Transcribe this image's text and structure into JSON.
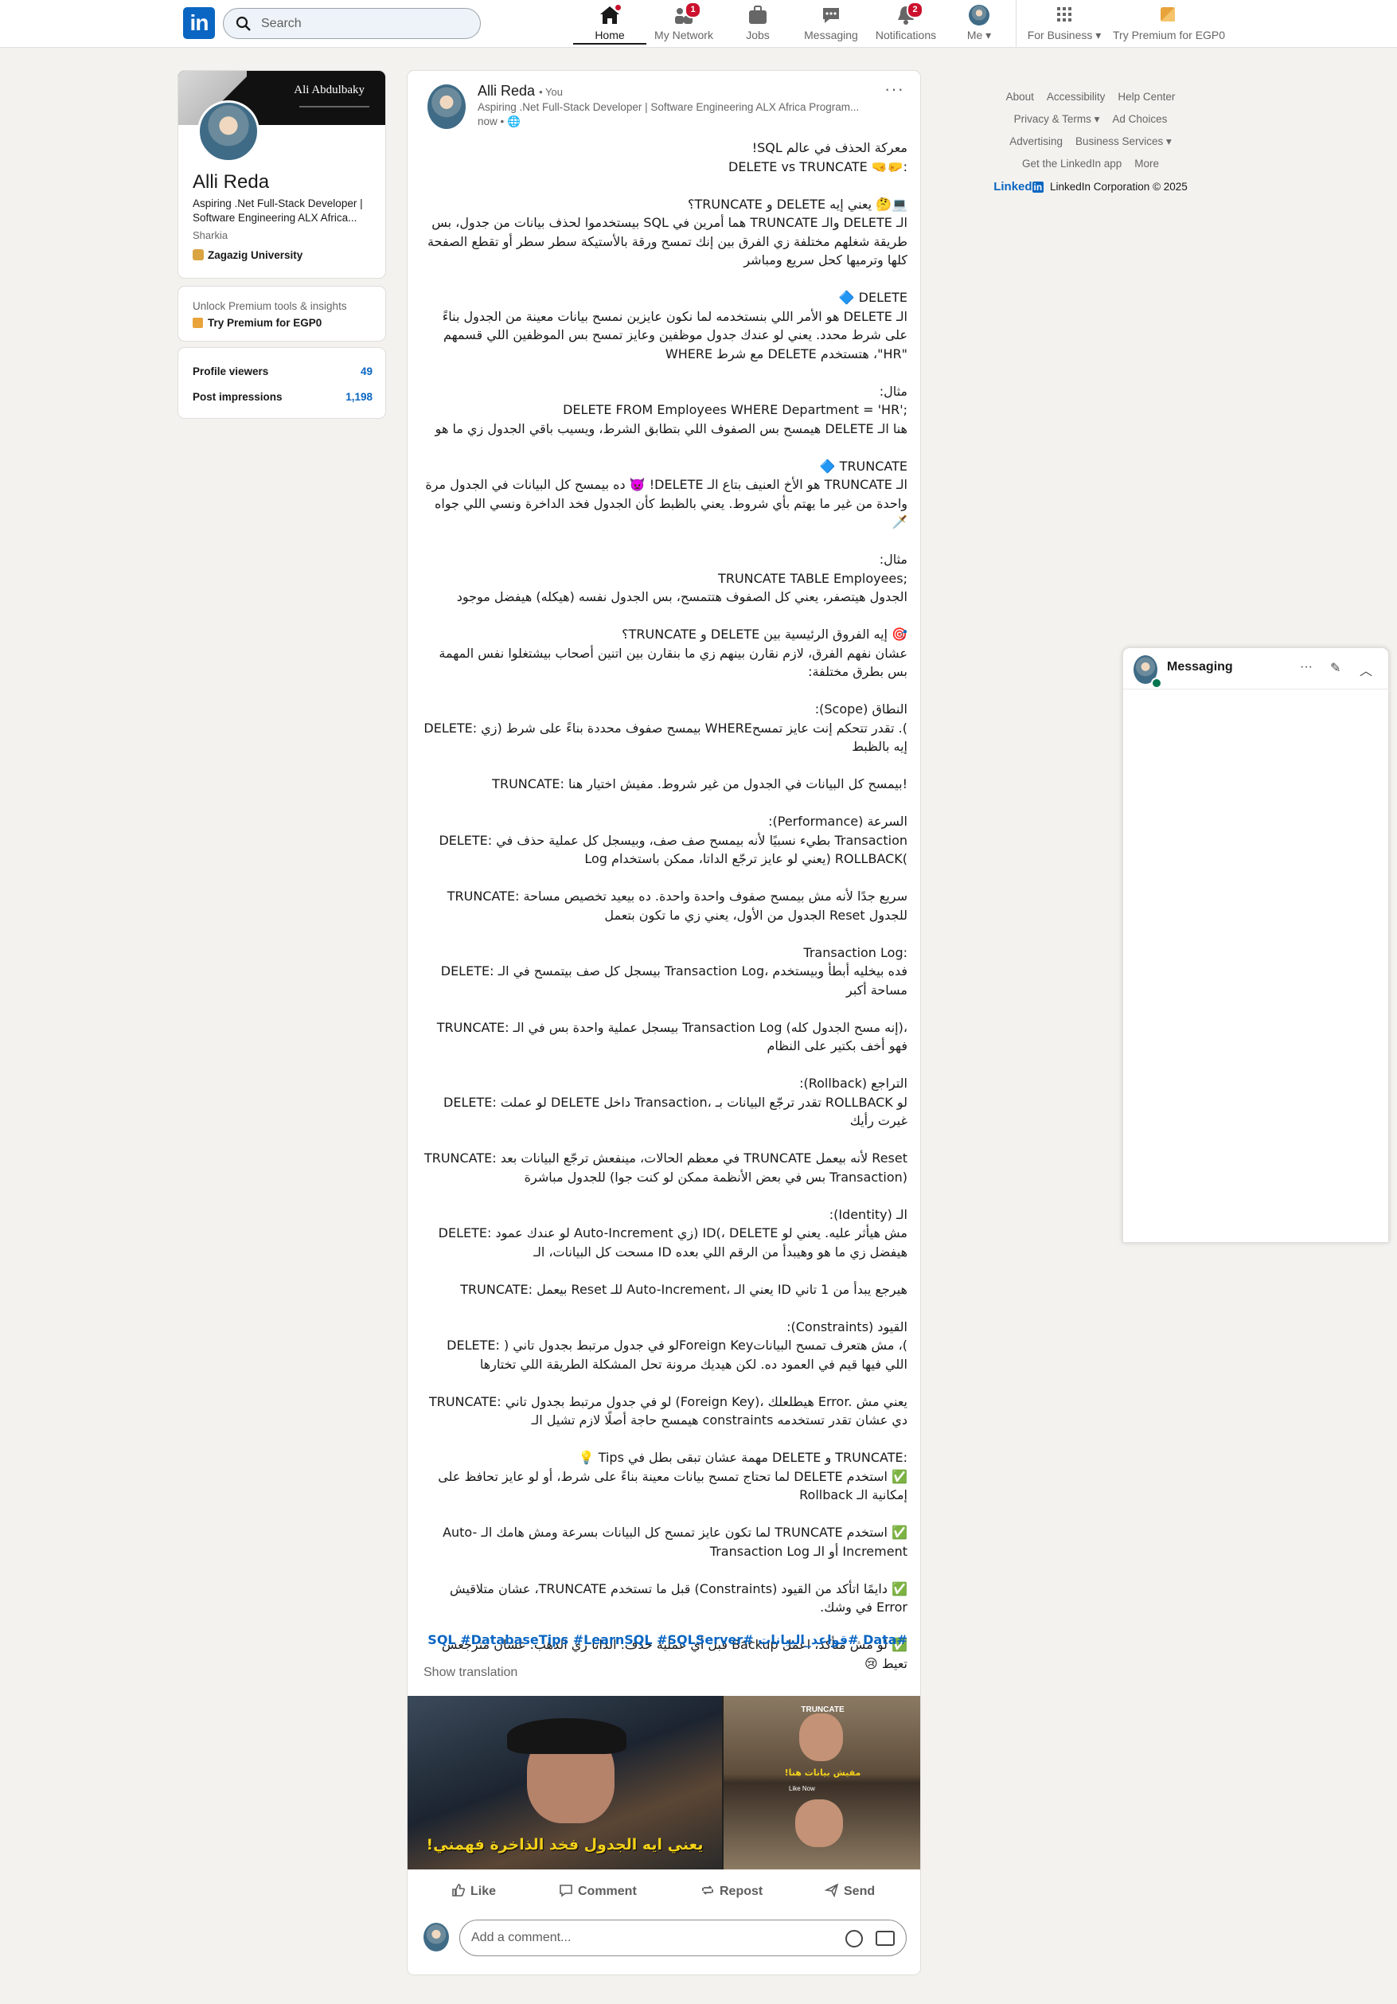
{
  "nav": {
    "logo": "in",
    "search_placeholder": "Search",
    "items": [
      {
        "label": "Home",
        "badge": ""
      },
      {
        "label": "My Network",
        "badge": "1"
      },
      {
        "label": "Jobs",
        "badge": ""
      },
      {
        "label": "Messaging",
        "badge": ""
      },
      {
        "label": "Notifications",
        "badge": "2"
      },
      {
        "label": "Me",
        "badge": ""
      },
      {
        "label": "For Business",
        "badge": ""
      },
      {
        "label": "Try Premium for EGP0",
        "badge": ""
      }
    ]
  },
  "profile": {
    "cover_name": "Ali Abdulbaky",
    "name": "Alli Reda",
    "headline": "Aspiring .Net Full-Stack Developer | Software Engineering ALX Africa...",
    "location": "Sharkia",
    "education": "Zagazig University"
  },
  "premium": {
    "line1": "Unlock Premium tools & insights",
    "line2": "Try Premium for EGP0"
  },
  "stats": [
    {
      "label": "Profile viewers",
      "value": "49"
    },
    {
      "label": "Post impressions",
      "value": "1,198"
    }
  ],
  "post": {
    "author": "Alli Reda",
    "you_label": "• You",
    "headline": "Aspiring .Net Full-Stack Developer | Software Engineering ALX Africa Program...",
    "time": "now •",
    "paragraphs": [
      "معركة الحذف في عالم SQL!\nDELETE vs TRUNCATE 🤜🤛:",
      "💻🤔 يعني إيه DELETE و TRUNCATE؟\nالـ DELETE والـ TRUNCATE هما أمرين في SQL بيستخدموا لحذف بيانات من جدول، بس طريقة شغلهم مختلفة زي الفرق بين إنك تمسح ورقة بالأستيكة سطر سطر أو تقطع الصفحة كلها وترميها كحل سريع ومباشر",
      "🔷 DELETE\nالـ DELETE هو الأمر اللي بنستخدمه لما نكون عايزين نمسح بيانات معينة من الجدول بناءً على شرط محدد. يعني لو عندك جدول موظفين وعايز تمسح بس الموظفين اللي قسمهم \"HR\"، هتستخدم DELETE مع شرط WHERE",
      "مثال:\nDELETE FROM Employees WHERE Department = 'HR';\nهنا الـ DELETE هيمسح بس الصفوف اللي بتطابق الشرط، ويسيب باقي الجدول زي ما هو",
      "🔷 TRUNCATE\nالـ TRUNCATE هو الأخ العنيف بتاع الـ DELETE! 👿 ده بيمسح كل البيانات في الجدول مرة واحدة من غير ما يهتم بأي شروط. يعني بالظبط كأن الجدول فخد الداخرة ونسي اللي جواه 🗡️",
      "مثال:\nTRUNCATE TABLE Employees;\nالجدول هيتصفر، يعني كل الصفوف هتتمسح، بس الجدول نفسه (هيكله) هيفضل موجود",
      "🎯 إيه الفروق الرئيسية بين DELETE و TRUNCATE؟\nعشان نفهم الفرق، لازم نقارن بينهم زي ما بنقارن بين اتنين أصحاب بيشتغلوا نفس المهمة بس بطرق مختلفة:",
      "النطاق (Scope):\nDELETE: بيمسح صفوف محددة بناءً على شرط (زي WHERE). تقدر تتحكم إنت عايز تمسح إيه بالظبط",
      "TRUNCATE: بيمسح كل البيانات في الجدول من غير شروط. مفيش اختيار هنا!",
      "السرعة (Performance):\nDELETE: بطيء نسبيًا لأنه بيمسح صف صف، وبيسجل كل عملية حذف في Transaction Log (يعني لو عايز ترجّع الداتا، ممكن باستخدام ROLLBACK)",
      "TRUNCATE: سريع جدًا لأنه مش بيمسح صفوف واحدة واحدة. ده بيعيد تخصيص مساحة الجدول من الأول، يعني زي ما تكون بتعمل Reset للجدول",
      "Transaction Log:\nDELETE: بيسجل كل صف بيتمسح في الـ Transaction Log، فده بيخليه أبطأ وبيستخدم مساحة أكبر",
      "TRUNCATE: بيسجل عملية واحدة بس في الـ Transaction Log (إنه مسح الجدول كله)، فهو أخف بكتير على النظام",
      "التراجع (Rollback):\nDELETE: لو عملت DELETE داخل Transaction، تقدر ترجّع البيانات بـ ROLLBACK لو غيرت رأيك",
      "TRUNCATE: في معظم الحالات، مينفعش ترجّع البيانات بعد TRUNCATE لأنه بيعمل Reset للجدول مباشرة (بس في بعض الأنظمة ممكن لو كنت جوا Transaction)",
      "الـ (Identity):\nDELETE: لو عندك عمود Auto-Increment (زي ID)، DELETE مش هيأثر عليه. يعني لو مسحت كل البيانات، الـ ID هيفضل زي ما هو وهيبدأ من الرقم اللي بعده",
      "TRUNCATE: بيعمل Reset للـ Auto-Increment، يعني الـ ID هيرجع يبدأ من 1 تاني",
      "القيود (Constraints):\nDELETE: لو في جدول مرتبط بجدول تاني (Foreign Key)، مش هتعرف تمسح البيانات اللي فيها قيم في العمود ده. لكن هيديك مرونة تحل المشكلة الطريقة اللي تختارها",
      "TRUNCATE: لو في جدول مرتبط بجدول تاني (Foreign Key)، هيطلعلك Error. يعني مش هيمسح حاجة أصلًا لازم تشيل الـ constraints دي عشان تقدر تستخدمه",
      "💡 Tips مهمة عشان تبقى بطل في DELETE و TRUNCATE:\n✅ استخدم DELETE لما تحتاج تمسح بيانات معينة بناءً على شرط، أو لو عايز تحافظ على إمكانية الـ Rollback",
      "✅ استخدم TRUNCATE لما تكون عايز تمسح كل البيانات بسرعة ومش هامك الـ Auto-Increment أو الـ Transaction Log",
      "✅ دايمًا اتأكد من القيود (Constraints) قبل ما تستخدم TRUNCATE، عشان متلاقيش Error في وشك.",
      "✅ لو مش متأكد، اعمل Backup قبل أي عملية حذف. الداتا زي الدهب. عشان مترجعش تعيط 😢"
    ],
    "hashtags": "#Data #قواعد_البيانات #SQL #DatabaseTips #LearnSQL #SQLServer",
    "show_translation": "Show translation",
    "media": {
      "left_caption": "يعني ايه الجدول فخد الذاخرة فهمني!",
      "right_top": "TRUNCATE",
      "right_caption": "مفيش بيانات هنا!",
      "right_small": "Like Now"
    },
    "actions": [
      "Like",
      "Comment",
      "Repost",
      "Send"
    ],
    "comment_placeholder": "Add a comment..."
  },
  "footer": {
    "rows": [
      [
        "About",
        "Accessibility",
        "Help Center"
      ],
      [
        "Privacy & Terms ▾",
        "Ad Choices"
      ],
      [
        "Advertising",
        "Business Services ▾"
      ],
      [
        "Get the LinkedIn app",
        "More"
      ]
    ],
    "brand": "Linked",
    "brand_in": "in",
    "copyright": "LinkedIn Corporation © 2025"
  },
  "messaging": {
    "title": "Messaging"
  },
  "colors": {
    "brand": "#0a66c2",
    "badge": "#cb112d",
    "background": "#f4f2ee",
    "online": "#01754f"
  }
}
